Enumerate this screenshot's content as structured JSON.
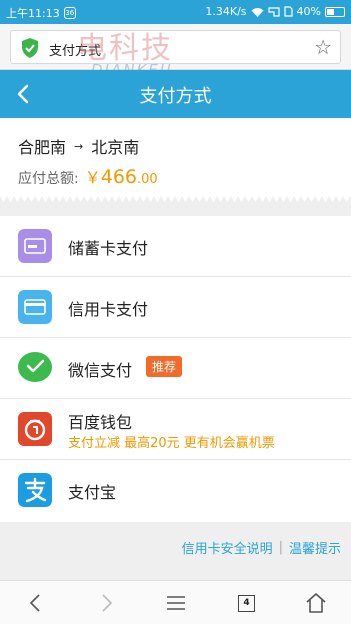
{
  "status_bar": {
    "time": "上午11:13",
    "notification": "36",
    "speed": "1.34K/s",
    "battery": "40%"
  },
  "address_bar": {
    "url_title": "支付方式",
    "watermark_main": "电科技",
    "watermark_sub": "DIANKEJI"
  },
  "header": {
    "title": "支付方式"
  },
  "order": {
    "from": "合肥南",
    "arrow": "→",
    "to": "北京南",
    "amount_label": "应付总额:",
    "currency": "￥",
    "amount_int": "466",
    "amount_dec": ".00"
  },
  "methods": [
    {
      "label": "储蓄卡支付",
      "color": "#a98ee8"
    },
    {
      "label": "信用卡支付",
      "color": "#49b3ee"
    },
    {
      "label": "微信支付",
      "color": "#3dba4e",
      "badge": "推荐"
    },
    {
      "label": "百度钱包",
      "color": "#e0472c",
      "sub": "支付立减 最高20元 更有机会赢机票"
    },
    {
      "label": "支付宝",
      "color": "#1c9de2"
    }
  ],
  "footer": {
    "link1": "信用卡安全说明",
    "divider": "|",
    "link2": "温馨提示"
  },
  "nav": {
    "tab_count": "4"
  },
  "colors": {
    "accent": "#2ba3d7",
    "price": "#f39800",
    "badge": "#f26b2a"
  }
}
